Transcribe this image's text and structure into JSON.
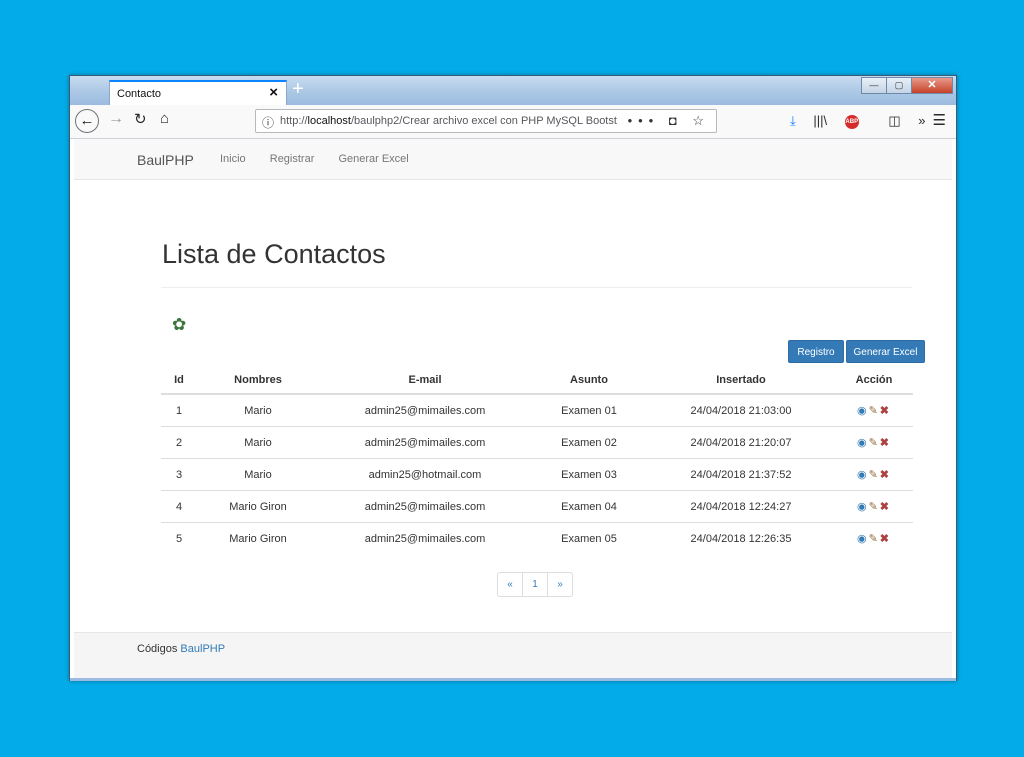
{
  "browser": {
    "tab_title": "Contacto",
    "url_prefix": "http://",
    "url_host": "localhost",
    "url_path": "/baulphp2/Crear archivo excel con PHP MySQL Bootst",
    "window_controls": [
      "minimize",
      "maximize",
      "close"
    ]
  },
  "site": {
    "brand": "BaulPHP",
    "nav": [
      "Inicio",
      "Registrar",
      "Generar Excel"
    ]
  },
  "page": {
    "title": "Lista de Contactos",
    "buttons": {
      "registro": "Registro",
      "generar_excel": "Generar Excel"
    }
  },
  "table": {
    "headers": [
      "Id",
      "Nombres",
      "E-mail",
      "Asunto",
      "Insertado",
      "Acción"
    ],
    "rows": [
      [
        "1",
        "Mario",
        "admin25@mimailes.com",
        "Examen 01",
        "24/04/2018 21:03:00"
      ],
      [
        "2",
        "Mario",
        "admin25@mimailes.com",
        "Examen 02",
        "24/04/2018 21:20:07"
      ],
      [
        "3",
        "Mario",
        "admin25@hotmail.com",
        "Examen 03",
        "24/04/2018 21:37:52"
      ],
      [
        "4",
        "Mario Giron",
        "admin25@mimailes.com",
        "Examen 04",
        "24/04/2018 12:24:27"
      ],
      [
        "5",
        "Mario Giron",
        "admin25@mimailes.com",
        "Examen 05",
        "24/04/2018 12:26:35"
      ]
    ],
    "action_icons": [
      "eye-icon",
      "pencil-icon",
      "delete-icon"
    ]
  },
  "pagination": {
    "prev": "«",
    "current": "1",
    "next": "»"
  },
  "footer": {
    "text": "Códigos",
    "link": "BaulPHP"
  },
  "colors": {
    "background": "#03ace8",
    "primary": "#337ab7",
    "gear": "#3c763d",
    "delete": "#a94442"
  }
}
